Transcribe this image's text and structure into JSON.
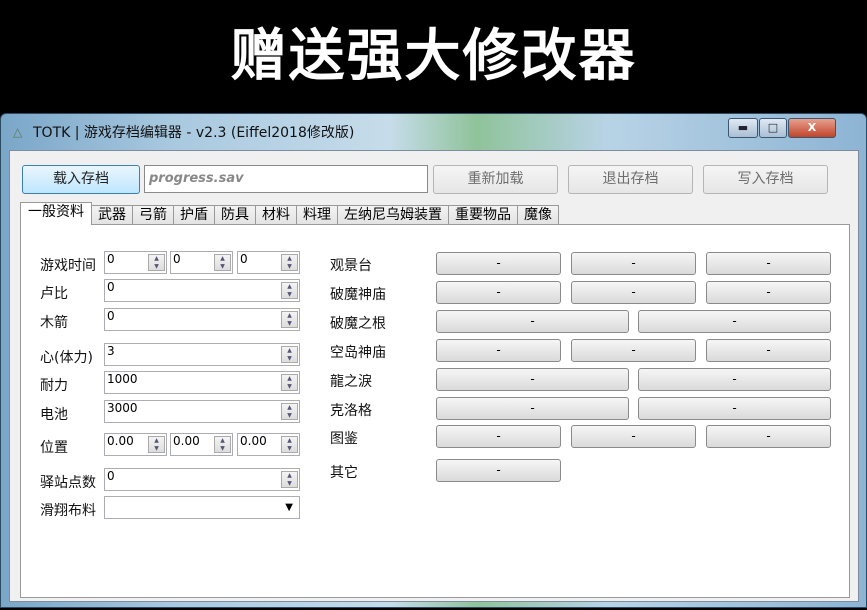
{
  "banner": "赠送强大修改器",
  "window": {
    "title": "TOTK | 游戏存档编辑器 - v2.3 (Eiffel2018修改版)",
    "min": "▬",
    "max": "□",
    "close": "X"
  },
  "toolbar": {
    "load": "载入存档",
    "file": "progress.sav",
    "reload": "重新加载",
    "exit": "退出存档",
    "write": "写入存档"
  },
  "tabs": [
    "一般资料",
    "武器",
    "弓箭",
    "护盾",
    "防具",
    "材料",
    "料理",
    "左纳尼乌姆装置",
    "重要物品",
    "魔像"
  ],
  "general": {
    "playtime_label": "游戏时间",
    "playtime": [
      "0",
      "0",
      "0"
    ],
    "rupee_label": "卢比",
    "rupee": "0",
    "arrow_label": "木箭",
    "arrow": "0",
    "heart_label": "心(体力)",
    "heart": "3",
    "stamina_label": "耐力",
    "stamina": "1000",
    "battery_label": "电池",
    "battery": "3000",
    "pos_label": "位置",
    "pos": [
      "0.00",
      "0.00",
      "0.00"
    ],
    "stations_label": "驿站点数",
    "stations": "0",
    "paraglider_label": "滑翔布料",
    "paraglider": ""
  },
  "unlocks": [
    {
      "label": "观景台",
      "buttons": [
        "-",
        "-",
        "-"
      ]
    },
    {
      "label": "破魔神庙",
      "buttons": [
        "-",
        "-",
        "-"
      ]
    },
    {
      "label": "破魔之根",
      "buttons": [
        "-",
        "-"
      ]
    },
    {
      "label": "空岛神庙",
      "buttons": [
        "-",
        "-",
        "-"
      ]
    },
    {
      "label": "龍之淚",
      "buttons": [
        "-",
        "-"
      ]
    },
    {
      "label": "克洛格",
      "buttons": [
        "-",
        "-"
      ]
    },
    {
      "label": "图鉴",
      "buttons": [
        "-",
        "-",
        "-"
      ]
    },
    {
      "label": "其它",
      "buttons": [
        "-"
      ]
    }
  ]
}
